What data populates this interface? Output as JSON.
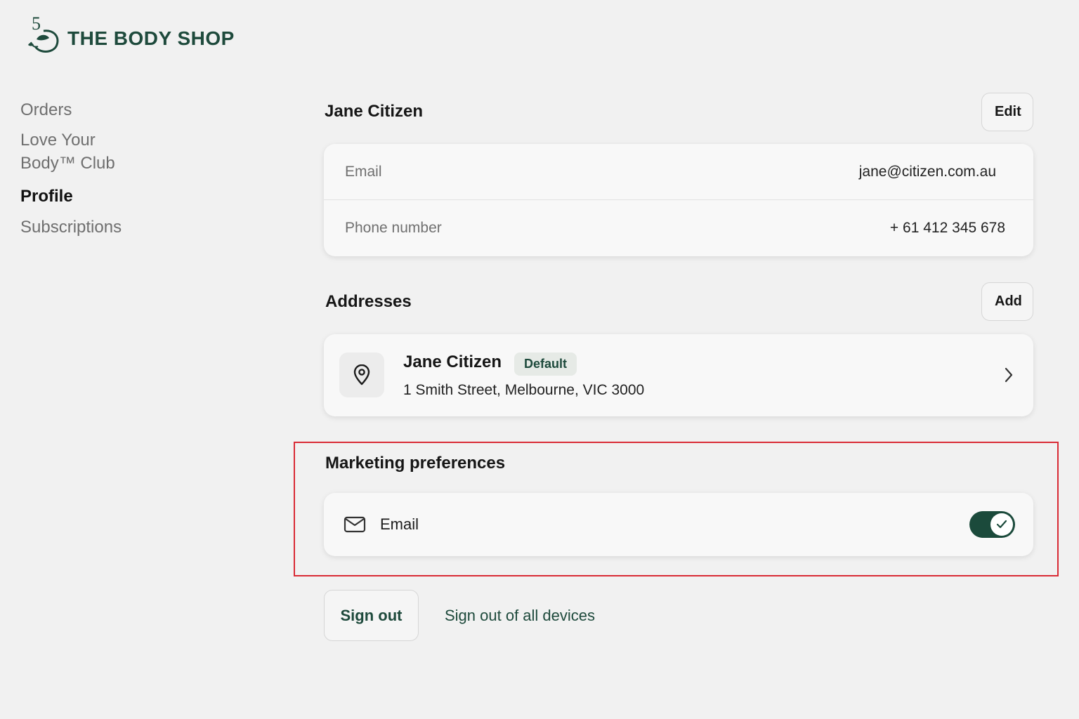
{
  "brand": {
    "name": "THE BODY SHOP",
    "logo_numeral": "5",
    "color": "#1e4a3c"
  },
  "sidebar": {
    "items": [
      {
        "label": "Orders",
        "active": false
      },
      {
        "label": "Love Your Body™ Club",
        "label_line1": "Love Your",
        "label_line2": "Body™ Club",
        "active": false
      },
      {
        "label": "Profile",
        "active": true
      },
      {
        "label": "Subscriptions",
        "active": false
      }
    ]
  },
  "profile": {
    "name": "Jane Citizen",
    "edit_label": "Edit",
    "fields": [
      {
        "label": "Email",
        "value": "jane@citizen.com.au"
      },
      {
        "label": "Phone number",
        "value": "+ 61 412 345 678"
      }
    ]
  },
  "addresses": {
    "title": "Addresses",
    "add_label": "Add",
    "items": [
      {
        "name": "Jane Citizen",
        "badge": "Default",
        "line": "1 Smith Street, Melbourne, VIC 3000",
        "icon": "location-pin-icon"
      }
    ]
  },
  "marketing": {
    "title": "Marketing preferences",
    "options": [
      {
        "label": "Email",
        "icon": "mail-icon",
        "enabled": true
      }
    ],
    "highlight_color": "#d92b35"
  },
  "actions": {
    "sign_out": "Sign out",
    "sign_out_all": "Sign out of all devices"
  },
  "colors": {
    "accent": "#1b4a3b",
    "background": "#f1f1f1",
    "card": "#f8f8f8"
  }
}
